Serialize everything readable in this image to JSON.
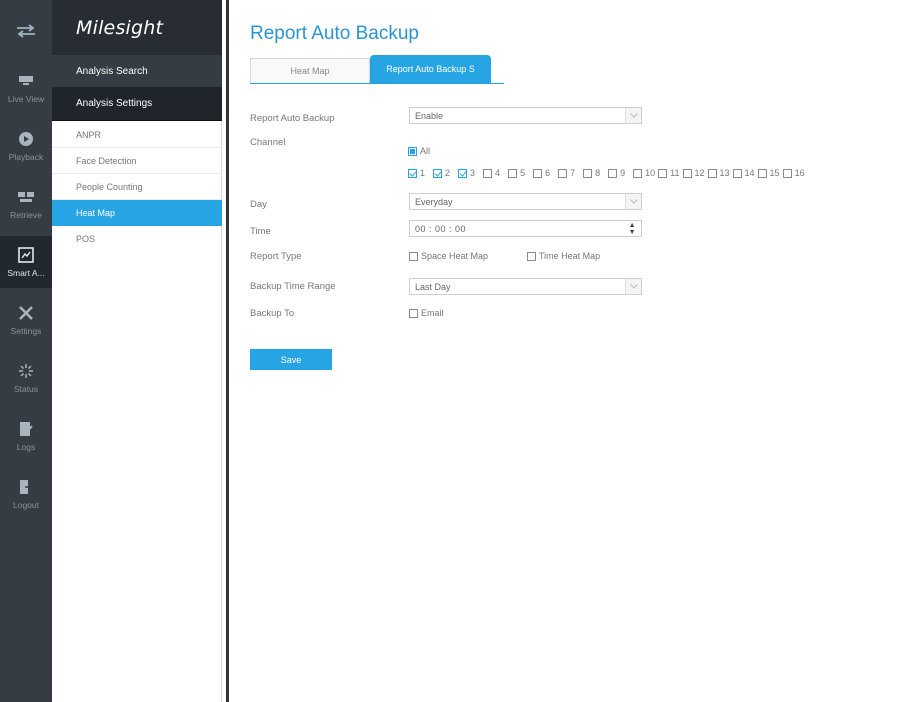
{
  "rail": {
    "items": [
      {
        "label": "Live View",
        "icon": "monitor-icon"
      },
      {
        "label": "Playback",
        "icon": "playback-icon"
      },
      {
        "label": "Retrieve",
        "icon": "retrieve-icon"
      },
      {
        "label": "Smart A...",
        "icon": "smart-analytics-icon"
      },
      {
        "label": "Settings",
        "icon": "settings-icon"
      },
      {
        "label": "Status",
        "icon": "status-icon"
      },
      {
        "label": "Logs",
        "icon": "logs-icon"
      },
      {
        "label": "Logout",
        "icon": "logout-icon"
      }
    ]
  },
  "nav": {
    "logo": "Milesight",
    "section1": "Analysis Search",
    "section2": "Analysis Settings",
    "items": [
      "ANPR",
      "Face Detection",
      "People Counting",
      "Heat Map",
      "POS"
    ]
  },
  "page": {
    "title": "Report Auto Backup",
    "tabs": [
      "Heat Map",
      "Report Auto Backup S"
    ]
  },
  "form": {
    "report_auto_backup_label": "Report Auto Backup",
    "report_auto_backup_value": "Enable",
    "channel_label": "Channel",
    "all_label": "All",
    "channels": [
      "1",
      "2",
      "3",
      "4",
      "5",
      "6",
      "7",
      "8",
      "9",
      "10",
      "11",
      "12",
      "13",
      "14",
      "15",
      "16"
    ],
    "checked_channels": [
      "1",
      "2",
      "3"
    ],
    "day_label": "Day",
    "day_value": "Everyday",
    "time_label": "Time",
    "time_value": "00 : 00 : 00",
    "report_type_label": "Report Type",
    "space_heat_map": "Space Heat Map",
    "time_heat_map": "Time Heat Map",
    "backup_time_range_label": "Backup Time Range",
    "backup_time_range_value": "Last Day",
    "backup_to_label": "Backup To",
    "email_label": "Email",
    "save": "Save"
  },
  "colors": {
    "accent": "#27a4e3",
    "rail_bg": "#353c43",
    "title": "#2a95d6"
  }
}
